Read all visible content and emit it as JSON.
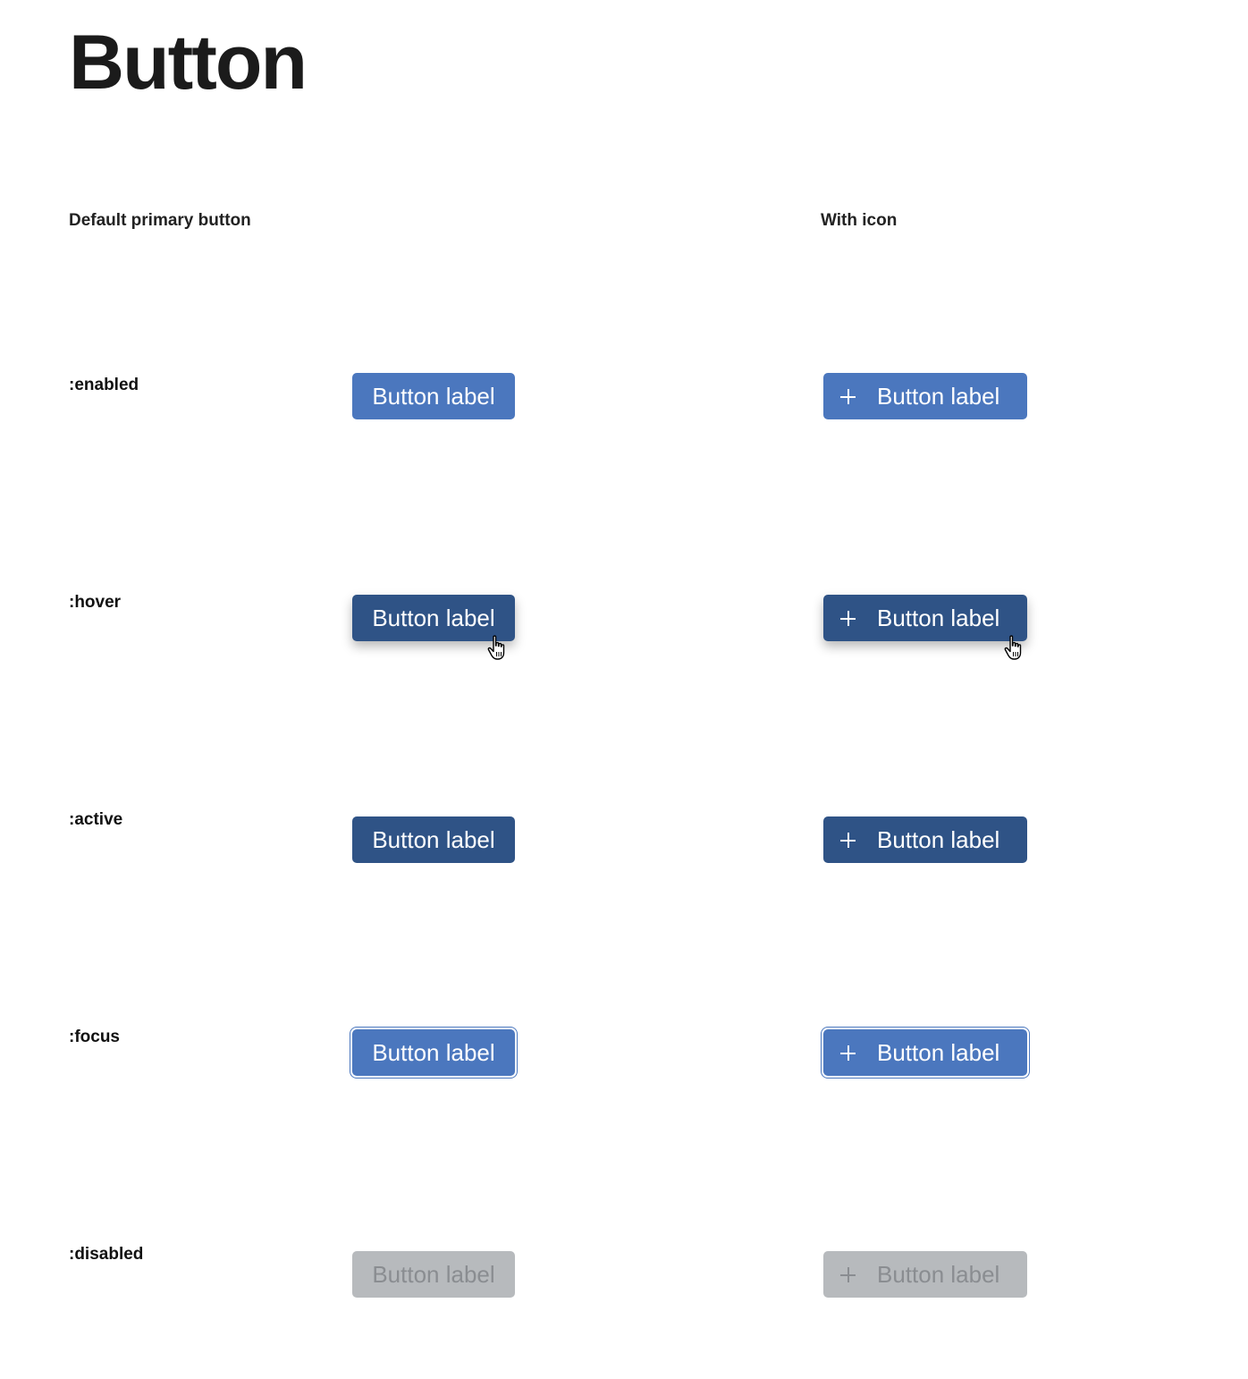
{
  "page": {
    "title": "Button"
  },
  "columns": {
    "default_heading": "Default primary button",
    "icon_heading": "With icon"
  },
  "states": [
    {
      "key": "enabled",
      "label": ":enabled",
      "button_label": "Button label"
    },
    {
      "key": "hover",
      "label": ":hover",
      "button_label": "Button label"
    },
    {
      "key": "active",
      "label": ":active",
      "button_label": "Button label"
    },
    {
      "key": "focus",
      "label": ":focus",
      "button_label": "Button label"
    },
    {
      "key": "disabled",
      "label": ":disabled",
      "button_label": "Button label"
    }
  ],
  "icons": {
    "button_icon": "plus-icon",
    "cursor_icon": "pointer-hand-icon"
  },
  "colors": {
    "enabled": "#4b77be",
    "hover": "#2f5386",
    "active": "#2f5386",
    "focus_ring": "#4b77be",
    "disabled_bg": "#b7babd",
    "disabled_text": "#8a8d91"
  }
}
